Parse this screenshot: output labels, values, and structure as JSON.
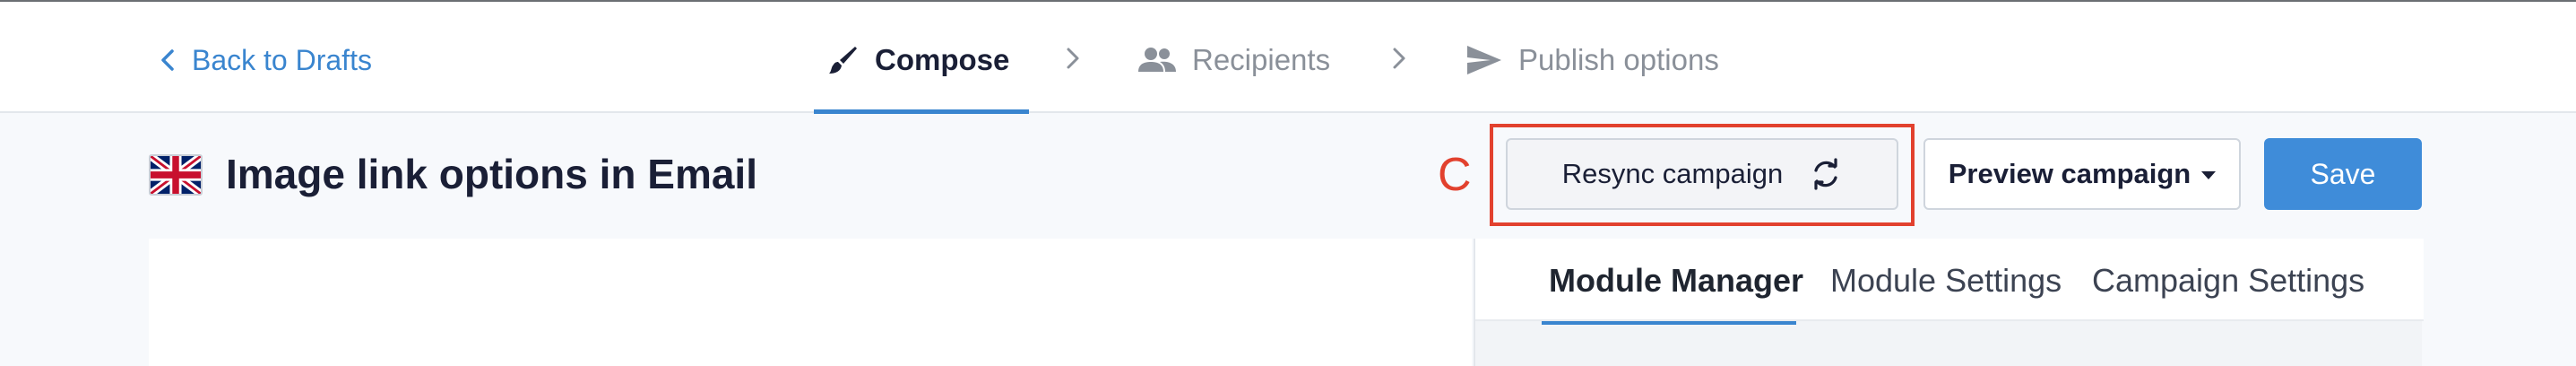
{
  "nav": {
    "back_label": "Back to Drafts",
    "steps": [
      {
        "label": "Compose",
        "icon": "brush-icon",
        "active": true
      },
      {
        "label": "Recipients",
        "icon": "people-icon",
        "active": false
      },
      {
        "label": "Publish options",
        "icon": "send-icon",
        "active": false
      }
    ]
  },
  "header": {
    "flag_icon": "uk-flag-icon",
    "title": "Image link options in Email",
    "annotation_letter": "C",
    "resync_label": "Resync campaign",
    "preview_label": "Preview campaign",
    "save_label": "Save"
  },
  "panel": {
    "tabs": [
      {
        "label": "Module Manager",
        "active": true
      },
      {
        "label": "Module Settings",
        "active": false
      },
      {
        "label": "Campaign Settings",
        "active": false
      }
    ]
  },
  "colors": {
    "accent": "#3a85cf",
    "save_button": "#3f8cd9",
    "annotation": "#e2412e",
    "text_dark": "#1a1f36"
  }
}
